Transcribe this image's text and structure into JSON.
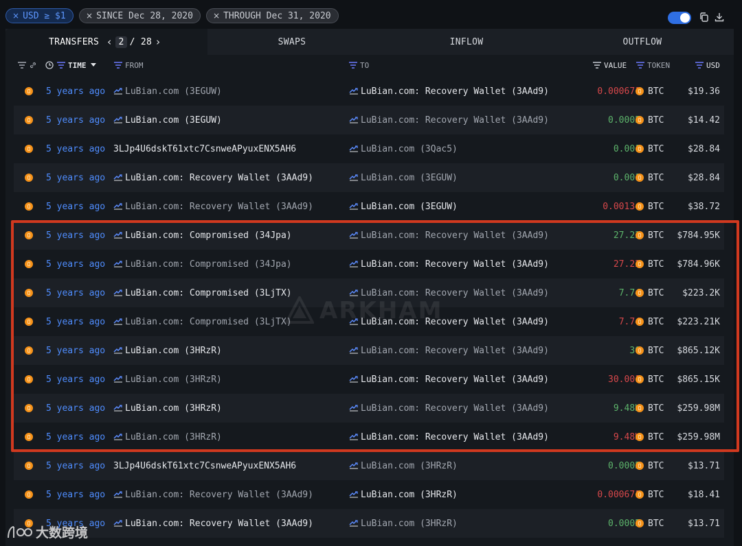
{
  "filters": {
    "usd": "USD ≥ $1",
    "since": "SINCE Dec 28, 2020",
    "through": "THROUGH Dec 31, 2020"
  },
  "icons": {
    "remove_filter": "×",
    "toggle": "toggle-on",
    "copy": "copy-icon",
    "download": "download-icon"
  },
  "tabs": {
    "transfers": "TRANSFERS",
    "page_current": "2",
    "page_total": "/ 28",
    "prev": "‹",
    "next": "›",
    "swaps": "SWAPS",
    "inflow": "INFLOW",
    "outflow": "OUTFLOW"
  },
  "columns": {
    "time": "TIME",
    "from": "FROM",
    "to": "TO",
    "value": "VALUE",
    "token": "TOKEN",
    "usd": "USD"
  },
  "rows": [
    {
      "time": "5 years ago",
      "from": "LuBian.com (3EGUW)",
      "from_icon": true,
      "from_bright": false,
      "to": "LuBian.com: Recovery Wallet (3AAd9)",
      "to_icon": true,
      "to_bright": true,
      "value": "0.000671",
      "value_color": "red",
      "token": "BTC",
      "usd": "$19.36"
    },
    {
      "time": "5 years ago",
      "from": "LuBian.com (3EGUW)",
      "from_icon": true,
      "from_bright": true,
      "to": "LuBian.com: Recovery Wallet (3AAd9)",
      "to_icon": true,
      "to_bright": false,
      "value": "0.0005",
      "value_color": "green",
      "token": "BTC",
      "usd": "$14.42"
    },
    {
      "time": "5 years ago",
      "from": "3LJp4U6dskT61xtc7CsnweAPyuxENX5AH6",
      "from_icon": false,
      "from_bright": true,
      "to": "LuBian.com (3Qac5)",
      "to_icon": true,
      "to_bright": false,
      "value": "0.001",
      "value_color": "green",
      "token": "BTC",
      "usd": "$28.84"
    },
    {
      "time": "5 years ago",
      "from": "LuBian.com: Recovery Wallet (3AAd9)",
      "from_icon": true,
      "from_bright": true,
      "to": "LuBian.com (3EGUW)",
      "to_icon": true,
      "to_bright": false,
      "value": "0.001",
      "value_color": "green",
      "token": "BTC",
      "usd": "$28.84"
    },
    {
      "time": "5 years ago",
      "from": "LuBian.com: Recovery Wallet (3AAd9)",
      "from_icon": true,
      "from_bright": false,
      "to": "LuBian.com (3EGUW)",
      "to_icon": true,
      "to_bright": true,
      "value": "0.00134",
      "value_color": "red",
      "token": "BTC",
      "usd": "$38.72"
    },
    {
      "time": "5 years ago",
      "from": "LuBian.com: Compromised (34Jpa)",
      "from_icon": true,
      "from_bright": true,
      "to": "LuBian.com: Recovery Wallet (3AAd9)",
      "to_icon": true,
      "to_bright": false,
      "value": "27.22",
      "value_color": "green",
      "token": "BTC",
      "usd": "$784.95K"
    },
    {
      "time": "5 years ago",
      "from": "LuBian.com: Compromised (34Jpa)",
      "from_icon": true,
      "from_bright": false,
      "to": "LuBian.com: Recovery Wallet (3AAd9)",
      "to_icon": true,
      "to_bright": true,
      "value": "27.22",
      "value_color": "red",
      "token": "BTC",
      "usd": "$784.96K"
    },
    {
      "time": "5 years ago",
      "from": "LuBian.com: Compromised (3LjTX)",
      "from_icon": true,
      "from_bright": true,
      "to": "LuBian.com: Recovery Wallet (3AAd9)",
      "to_icon": true,
      "to_bright": false,
      "value": "7.74",
      "value_color": "green",
      "token": "BTC",
      "usd": "$223.2K"
    },
    {
      "time": "5 years ago",
      "from": "LuBian.com: Compromised (3LjTX)",
      "from_icon": true,
      "from_bright": false,
      "to": "LuBian.com: Recovery Wallet (3AAd9)",
      "to_icon": true,
      "to_bright": true,
      "value": "7.74",
      "value_color": "red",
      "token": "BTC",
      "usd": "$223.21K"
    },
    {
      "time": "5 years ago",
      "from": "LuBian.com (3HRzR)",
      "from_icon": true,
      "from_bright": true,
      "to": "LuBian.com: Recovery Wallet (3AAd9)",
      "to_icon": true,
      "to_bright": false,
      "value": "30",
      "value_color": "green",
      "token": "BTC",
      "usd": "$865.12K"
    },
    {
      "time": "5 years ago",
      "from": "LuBian.com (3HRzR)",
      "from_icon": true,
      "from_bright": false,
      "to": "LuBian.com: Recovery Wallet (3AAd9)",
      "to_icon": true,
      "to_bright": true,
      "value": "30.001",
      "value_color": "red",
      "token": "BTC",
      "usd": "$865.15K"
    },
    {
      "time": "5 years ago",
      "from": "LuBian.com (3HRzR)",
      "from_icon": true,
      "from_bright": true,
      "to": "LuBian.com: Recovery Wallet (3AAd9)",
      "to_icon": true,
      "to_bright": false,
      "value": "9.48K",
      "value_color": "green",
      "token": "BTC",
      "usd": "$259.98M"
    },
    {
      "time": "5 years ago",
      "from": "LuBian.com (3HRzR)",
      "from_icon": true,
      "from_bright": false,
      "to": "LuBian.com: Recovery Wallet (3AAd9)",
      "to_icon": true,
      "to_bright": true,
      "value": "9.48K",
      "value_color": "red",
      "token": "BTC",
      "usd": "$259.98M"
    },
    {
      "time": "5 years ago",
      "from": "3LJp4U6dskT61xtc7CsnweAPyuxENX5AH6",
      "from_icon": false,
      "from_bright": true,
      "to": "LuBian.com (3HRzR)",
      "to_icon": true,
      "to_bright": false,
      "value": "0.0005",
      "value_color": "green",
      "token": "BTC",
      "usd": "$13.71"
    },
    {
      "time": "5 years ago",
      "from": "LuBian.com: Recovery Wallet (3AAd9)",
      "from_icon": true,
      "from_bright": false,
      "to": "LuBian.com (3HRzR)",
      "to_icon": true,
      "to_bright": true,
      "value": "0.000671",
      "value_color": "red",
      "token": "BTC",
      "usd": "$18.41"
    },
    {
      "time": "5 years ago",
      "from": "LuBian.com: Recovery Wallet (3AAd9)",
      "from_icon": true,
      "from_bright": true,
      "to": "LuBian.com (3HRzR)",
      "to_icon": true,
      "to_bright": false,
      "value": "0.0005",
      "value_color": "green",
      "token": "BTC",
      "usd": "$13.71"
    }
  ],
  "colors": {
    "accent": "#4f8dff",
    "positive": "#5db46b",
    "negative": "#d8484b",
    "btc": "#f7931a",
    "highlight_border": "#d1391f"
  },
  "watermark": {
    "logo": "arkham-logo",
    "text": "ARKHAM"
  },
  "corner_logo": {
    "text": "大数跨境"
  }
}
